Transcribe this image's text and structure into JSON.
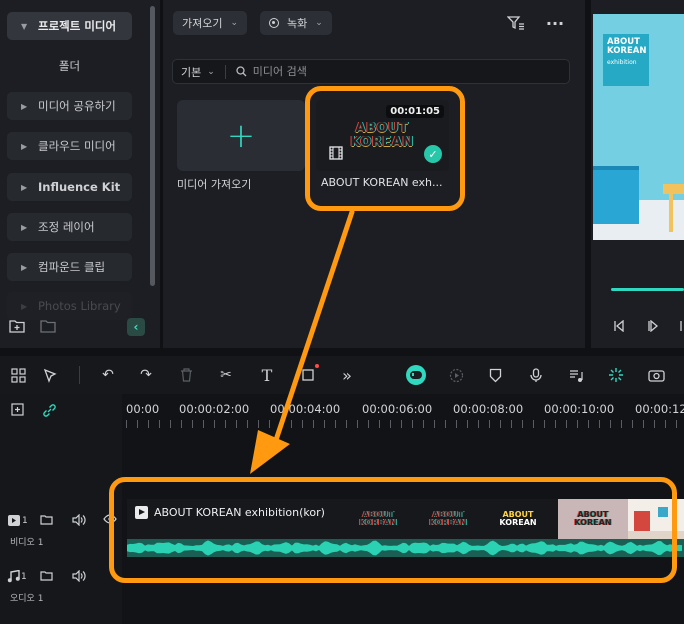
{
  "sidebar": {
    "items": [
      {
        "label": "프로젝트 미디어"
      },
      {
        "label": "폴더"
      },
      {
        "label": "미디어 공유하기"
      },
      {
        "label": "클라우드 미디어"
      },
      {
        "label": "Influence Kit"
      },
      {
        "label": "조정 레이어"
      },
      {
        "label": "컴파운드 클립"
      },
      {
        "label": "Photos Library"
      }
    ]
  },
  "media": {
    "import_dropdown": "가져오기",
    "record_dropdown": "녹화",
    "filter_dropdown": "기본",
    "search_placeholder": "미디어 검색",
    "import_tile_label": "미디어 가져오기",
    "clip": {
      "duration": "00:01:05",
      "name": "ABOUT KOREAN exh...",
      "logo_line1": "ABOUT",
      "logo_line2": "KOREAN"
    }
  },
  "preview": {
    "poster_line1": "ABOUT",
    "poster_line2": "KOREAN",
    "poster_sub": "exhibition"
  },
  "timeline": {
    "ruler_labels": [
      "00:00",
      "00:00:02:00",
      "00:00:04:00",
      "00:00:06:00",
      "00:00:08:00",
      "00:00:10:00",
      "00:00:12"
    ],
    "tracks": [
      {
        "count": "1",
        "name": "비디오 1"
      },
      {
        "count": "1",
        "name": "오디오 1"
      }
    ],
    "clip_title": "ABOUT KOREAN exhibition(kor)",
    "thumb_line1": "ABOUT",
    "thumb_line2": "KOREAN"
  },
  "colors": {
    "accent": "#2fd8bf",
    "annotation": "#ff9910",
    "audio_wave": "#2ad1b3"
  }
}
